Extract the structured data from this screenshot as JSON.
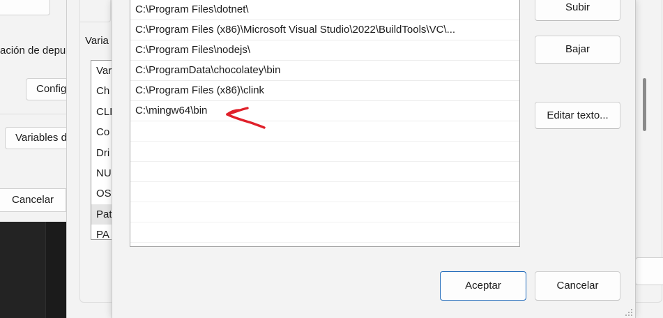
{
  "background_dialog": {
    "label_debug": "ación de depur",
    "config_button": "Config",
    "env_vars_button": "Variables d",
    "cancel_button": "Cancelar"
  },
  "env_dialog": {
    "groupbox_label": "Varia",
    "system_vars_list": [
      "Var",
      "Ch",
      "CLI",
      "Co",
      "Dri",
      "NU",
      "OS",
      "Pat",
      "PA"
    ],
    "selected_index": 7
  },
  "edit_dialog": {
    "path_entries": [
      "C:\\Program Files\\dotnet\\",
      "C:\\Program Files (x86)\\Microsoft Visual Studio\\2022\\BuildTools\\VC\\...",
      "C:\\Program Files\\nodejs\\",
      "C:\\ProgramData\\chocolatey\\bin",
      "C:\\Program Files (x86)\\clink",
      "C:\\mingw64\\bin",
      "",
      "",
      "",
      "",
      "",
      ""
    ],
    "buttons": {
      "up": "Subir",
      "down": "Bajar",
      "edit_text": "Editar texto...",
      "accept": "Aceptar",
      "cancel": "Cancelar"
    }
  },
  "annotation": {
    "arrow_color": "#e0202a",
    "arrow_icon": "red-hand-drawn-arrow-icon"
  },
  "colors": {
    "accent_focus_border": "#1a66b8",
    "terminal_bg": "#1b1b1b"
  }
}
